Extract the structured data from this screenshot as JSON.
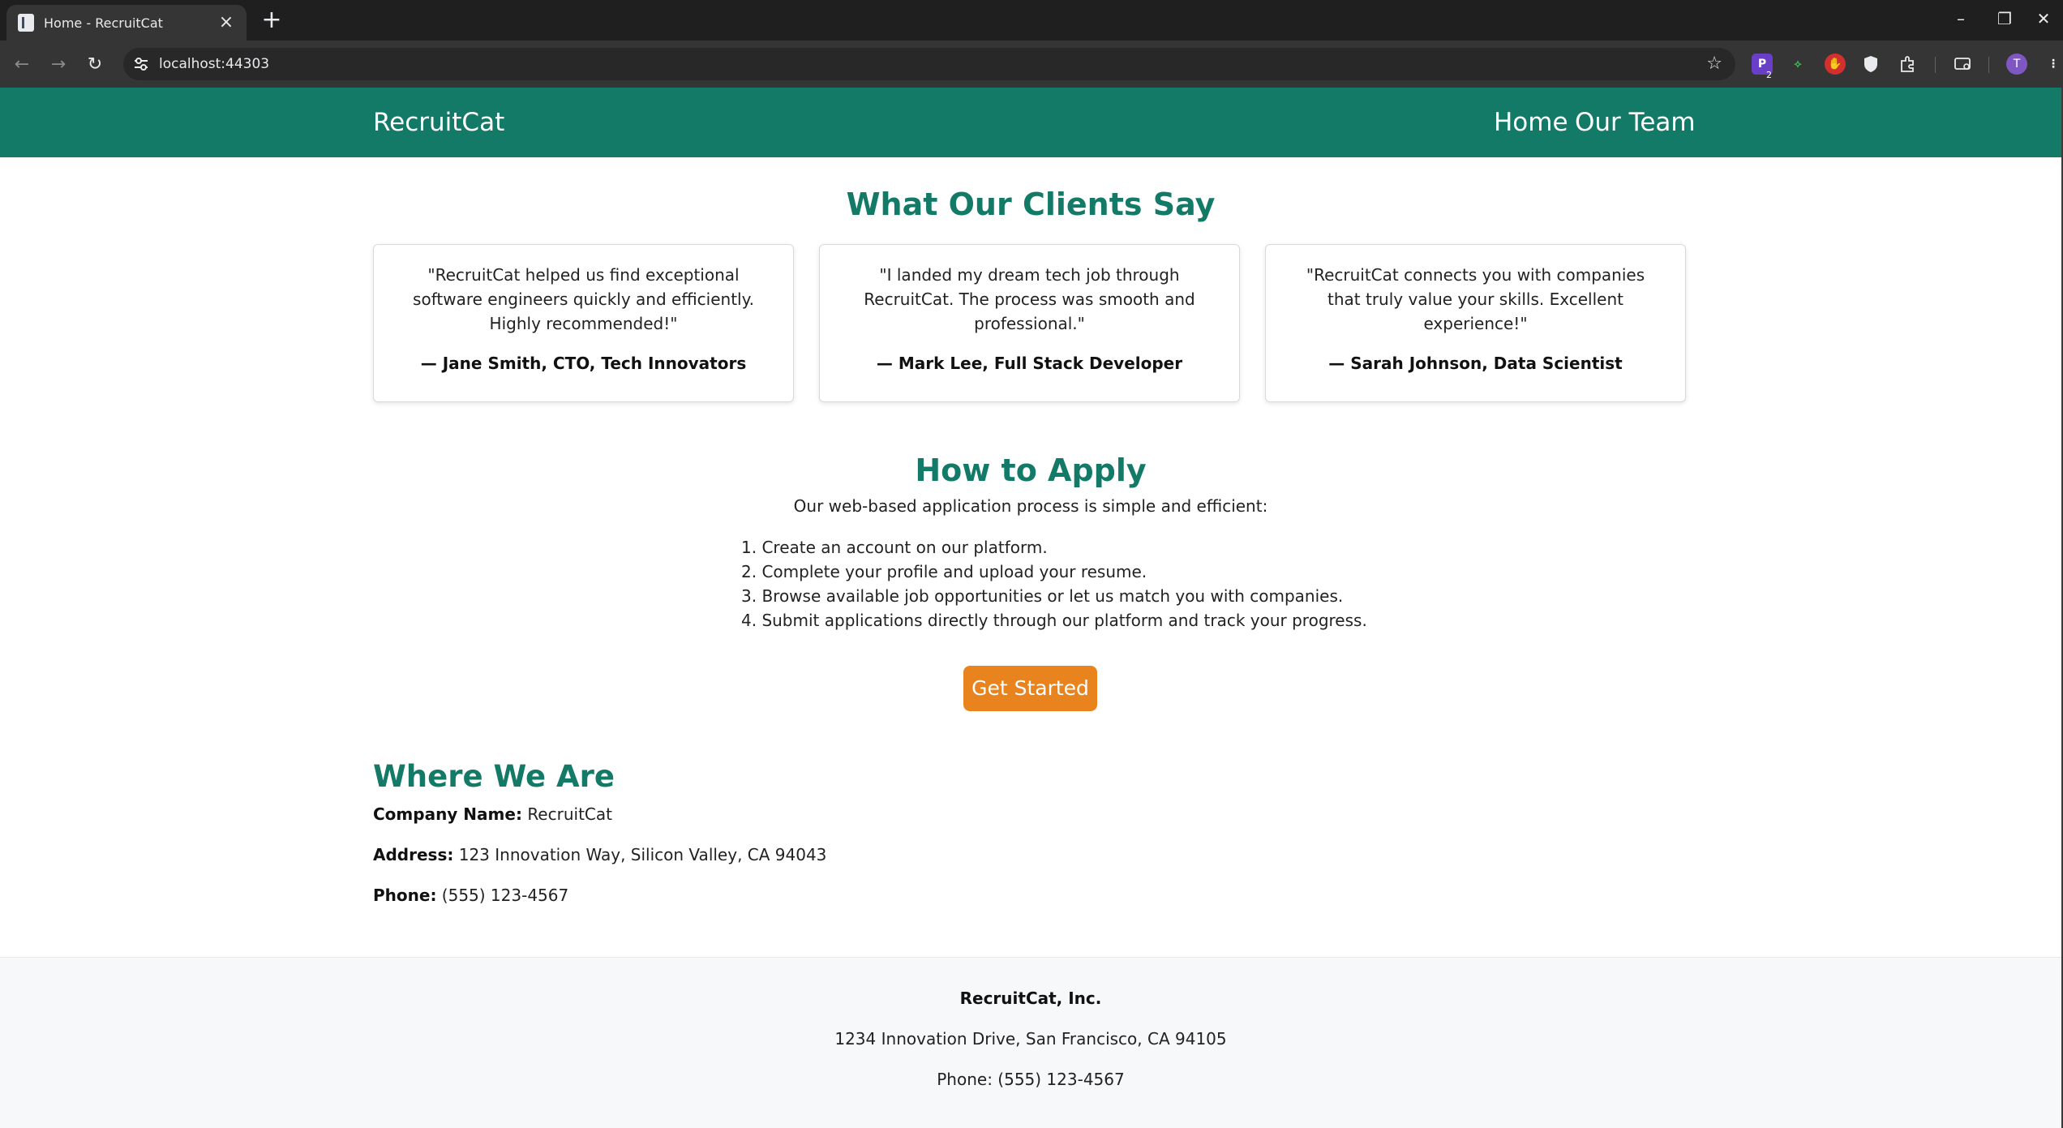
{
  "browser": {
    "tab_title": "Home - RecruitCat",
    "url": "localhost:44303",
    "extension_badge": "2",
    "profile_initial": "T"
  },
  "site": {
    "brand": "RecruitCat",
    "nav": [
      "Home",
      "Our Team"
    ]
  },
  "testimonials": {
    "title": "What Our Clients Say",
    "items": [
      {
        "quote": "\"RecruitCat helped us find exceptional software engineers quickly and efficiently. Highly recommended!\"",
        "author": "— Jane Smith, CTO, Tech Innovators"
      },
      {
        "quote": "\"I landed my dream tech job through RecruitCat. The process was smooth and professional.\"",
        "author": "— Mark Lee, Full Stack Developer"
      },
      {
        "quote": "\"RecruitCat connects you with companies that truly value your skills. Excellent experience!\"",
        "author": "— Sarah Johnson, Data Scientist"
      }
    ]
  },
  "apply": {
    "title": "How to Apply",
    "intro": "Our web-based application process is simple and efficient:",
    "steps": [
      "1. Create an account on our platform.",
      "2. Complete your profile and upload your resume.",
      "3. Browse available job opportunities or let us match you with companies.",
      "4. Submit applications directly through our platform and track your progress."
    ],
    "cta": "Get Started"
  },
  "location": {
    "title": "Where We Are",
    "company_label": "Company Name:",
    "company_value": "RecruitCat",
    "address_label": "Address:",
    "address_value": "123 Innovation Way, Silicon Valley, CA 94043",
    "phone_label": "Phone:",
    "phone_value": "(555) 123-4567"
  },
  "footer": {
    "name": "RecruitCat, Inc.",
    "address": "1234 Innovation Drive, San Francisco, CA 94105",
    "phone": "Phone: (555) 123-4567"
  },
  "colors": {
    "primary": "#127a66",
    "accent": "#e8831e",
    "footer_bg": "#f7f8f9"
  }
}
